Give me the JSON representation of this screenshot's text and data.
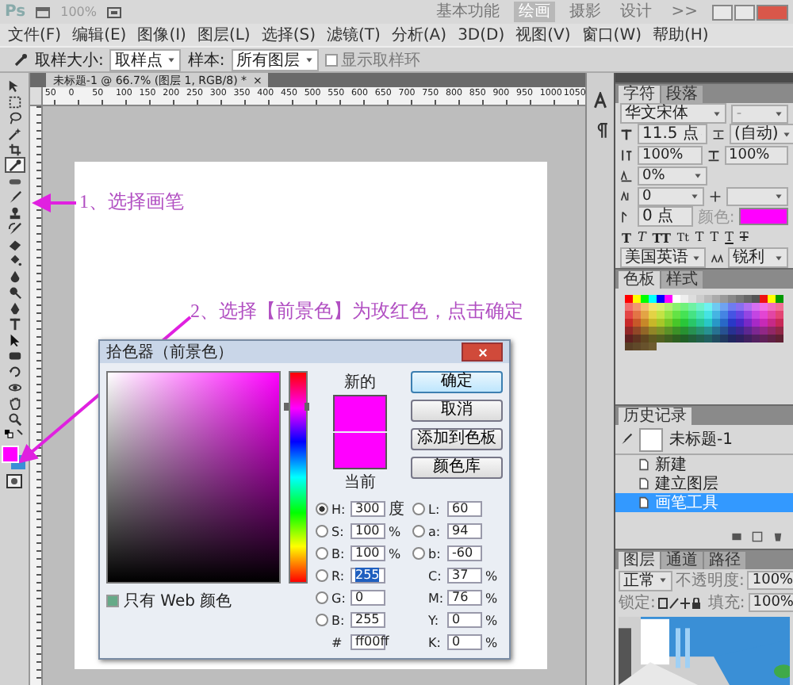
{
  "app_bar": {
    "logo": "Ps",
    "zoom": "100%",
    "workspaces": [
      {
        "label": "基本功能",
        "selected": false
      },
      {
        "label": "绘画",
        "selected": true
      },
      {
        "label": "摄影",
        "selected": false
      },
      {
        "label": "设计",
        "selected": false
      }
    ],
    "more": ">>"
  },
  "menu": [
    "文件(F)",
    "编辑(E)",
    "图像(I)",
    "图层(L)",
    "选择(S)",
    "滤镜(T)",
    "分析(A)",
    "3D(D)",
    "视图(V)",
    "窗口(W)",
    "帮助(H)"
  ],
  "options_bar": {
    "sample_size_label": "取样大小:",
    "sample_size": "取样点",
    "sample_label": "样本:",
    "sample": "所有图层",
    "sample_ring": {
      "label": "显示取样环",
      "checked": false,
      "disabled": true
    }
  },
  "document": {
    "tab": "未标题-1 @ 66.7% (图层 1, RGB/8) *",
    "close": "×",
    "ruler_labels": [
      "50",
      "0",
      "50",
      "100",
      "150",
      "200",
      "250",
      "300",
      "350",
      "400",
      "450",
      "500",
      "550",
      "600",
      "650",
      "700",
      "750",
      "800",
      "850",
      "900",
      "950",
      "1000",
      "1050"
    ]
  },
  "tools": [
    {
      "kind": "move",
      "selected": false
    },
    {
      "kind": "marquee",
      "selected": false
    },
    {
      "kind": "lasso",
      "selected": false
    },
    {
      "kind": "wand",
      "selected": false
    },
    {
      "kind": "crop",
      "selected": false
    },
    {
      "kind": "eyedropper",
      "selected": true
    },
    {
      "kind": "heal",
      "selected": false
    },
    {
      "kind": "brush",
      "selected": false
    },
    {
      "kind": "stamp",
      "selected": false
    },
    {
      "kind": "history",
      "selected": false
    },
    {
      "kind": "eraser",
      "selected": false
    },
    {
      "kind": "bucket",
      "selected": false
    },
    {
      "kind": "blur",
      "selected": false
    },
    {
      "kind": "dodge",
      "selected": false
    },
    {
      "kind": "pen",
      "selected": false
    },
    {
      "kind": "type",
      "selected": false
    },
    {
      "kind": "select",
      "selected": false
    },
    {
      "kind": "shape",
      "selected": false
    },
    {
      "kind": "rotate",
      "selected": false
    },
    {
      "kind": "orbit",
      "selected": false
    },
    {
      "kind": "hand",
      "selected": false
    },
    {
      "kind": "zoom",
      "selected": false
    }
  ],
  "color_swatches": [
    {
      "kind": "foreground",
      "color": "#ff00ff"
    },
    {
      "kind": "background",
      "color": "#3a8fd6"
    }
  ],
  "annotations": [
    {
      "text": "1、选择画笔"
    },
    {
      "text": "2、选择【前景色】为玫红色，点击确定"
    }
  ],
  "color_picker": {
    "title": "拾色器（前景色）",
    "hue_slider": {
      "level": 0.83
    },
    "preview": [
      {
        "label": "新的",
        "color": "#ff00ff"
      },
      {
        "label": "当前",
        "color": "#ff00ff"
      }
    ],
    "buttons": [
      {
        "label": "确定",
        "kind": "default"
      },
      {
        "label": "取消",
        "kind": "normal"
      },
      {
        "label": "添加到色板",
        "kind": "normal"
      },
      {
        "label": "颜色库",
        "kind": "normal"
      }
    ],
    "fields_left": [
      {
        "label": "H:",
        "value": "300",
        "unit": "度",
        "selected": true,
        "highlighted": false
      },
      {
        "label": "S:",
        "value": "100",
        "unit": "%",
        "selected": false,
        "highlighted": false
      },
      {
        "label": "B:",
        "value": "100",
        "unit": "%",
        "selected": false,
        "highlighted": false
      },
      {
        "label": "R:",
        "value": "255",
        "selected": false,
        "highlighted": true
      },
      {
        "label": "G:",
        "value": "0",
        "selected": false,
        "highlighted": false
      },
      {
        "label": "B:",
        "value": "255",
        "selected": false,
        "highlighted": false
      }
    ],
    "fields_lab": [
      {
        "label": "L:",
        "value": "60",
        "selected": false
      },
      {
        "label": "a:",
        "value": "94",
        "selected": false
      },
      {
        "label": "b:",
        "value": "-60",
        "selected": false
      }
    ],
    "fields_cmyk": [
      {
        "label": "C:",
        "value": "37",
        "unit": "%"
      },
      {
        "label": "M:",
        "value": "76",
        "unit": "%"
      },
      {
        "label": "Y:",
        "value": "0",
        "unit": "%"
      },
      {
        "label": "K:",
        "value": "0",
        "unit": "%"
      }
    ],
    "hex": {
      "label": "#",
      "value": "ff00ff"
    },
    "web_only": {
      "label": "只有 Web 颜色",
      "checked": true
    }
  },
  "character_panel": {
    "tabs": [
      {
        "label": "字符",
        "selected": true
      },
      {
        "label": "段落",
        "selected": false
      }
    ],
    "font_family": "华文宋体",
    "font_style": "-",
    "font_size": "11.5 点",
    "leading": "(自动)",
    "vertical_scale": "100%",
    "horizontal_scale": "100%",
    "tracking": "0%",
    "kerning": "0",
    "baseline_shift": "0 点",
    "color_label": "颜色:",
    "color": "#ff00ff",
    "type_styles": [
      {
        "glyph": "T",
        "kind": "bold"
      },
      {
        "glyph": "T",
        "kind": "italic"
      },
      {
        "glyph": "TT",
        "kind": "caps"
      },
      {
        "glyph": "Tt",
        "kind": "smallcaps"
      },
      {
        "glyph": "T",
        "kind": "super"
      },
      {
        "glyph": "T",
        "kind": "sub"
      },
      {
        "glyph": "T",
        "kind": "underline"
      },
      {
        "glyph": "T",
        "kind": "strike"
      }
    ],
    "language": "美国英语",
    "antialias": "锐利"
  },
  "swatches_panel": {
    "tabs": [
      {
        "label": "色板",
        "selected": true
      },
      {
        "label": "样式",
        "selected": false
      }
    ]
  },
  "history_panel": {
    "title": "历史记录",
    "snapshot": "未标题-1",
    "steps": [
      {
        "label": "新建",
        "selected": false
      },
      {
        "label": "建立图层",
        "selected": false
      },
      {
        "label": "画笔工具",
        "selected": true
      }
    ]
  },
  "layers_panel": {
    "tabs": [
      {
        "label": "图层",
        "selected": true
      },
      {
        "label": "通道",
        "selected": false
      },
      {
        "label": "路径",
        "selected": false
      }
    ],
    "blend_mode": "正常",
    "opacity_label": "不透明度:",
    "opacity": "100%",
    "lock_label": "锁定:",
    "fill_label": "填充:",
    "fill": "100%"
  }
}
